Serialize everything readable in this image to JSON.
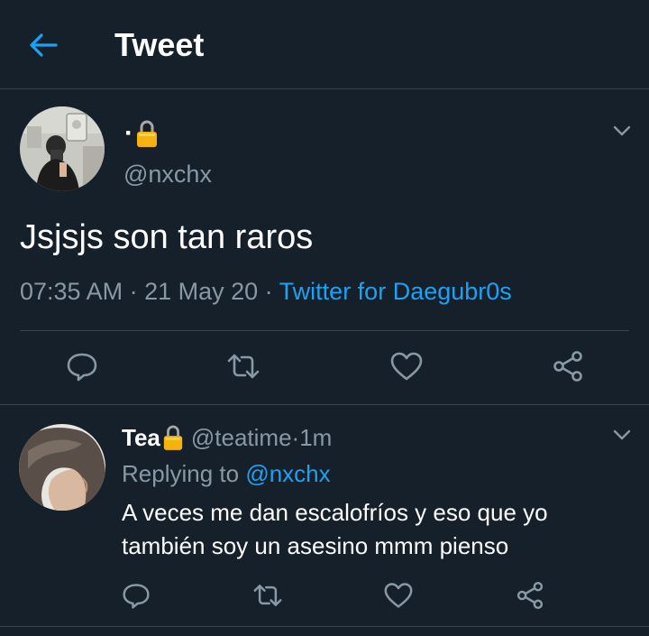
{
  "header": {
    "title": "Tweet"
  },
  "tweet": {
    "name": "·",
    "handle": "@nxchx",
    "text": "Jsjsjs son tan raros",
    "time": "07:35 AM",
    "sep1": " · ",
    "date": "21 May 20",
    "sep2": " · ",
    "source": "Twitter for Daegubr0s"
  },
  "reply": {
    "name": "Tea",
    "handle": "@teatime",
    "sep": " · ",
    "time": "1m",
    "replying_prefix": "Replying to ",
    "replying_to": "@nxchx",
    "line1": "A veces me dan escalofríos y eso que yo",
    "line2": "también soy un asesino mmm pienso"
  },
  "colors": {
    "background": "#15202b",
    "accent": "#1da1f2",
    "secondary_text": "#8899a6",
    "divider": "#38444d",
    "lock": "#f5b30f"
  },
  "icons": [
    "back-arrow-icon",
    "lock-icon",
    "chevron-down-icon",
    "reply-icon",
    "retweet-icon",
    "like-icon",
    "share-icon"
  ]
}
